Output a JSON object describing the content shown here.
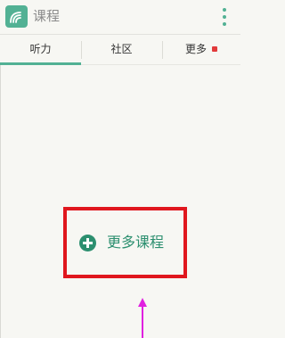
{
  "header": {
    "title": "课程",
    "logo_icon": "wifi-signal-icon",
    "menu_icon": "overflow-menu-icon"
  },
  "tabs": [
    {
      "label": "听力",
      "active": true
    },
    {
      "label": "社区",
      "active": false
    },
    {
      "label": "更多",
      "active": false,
      "badge": true
    }
  ],
  "main": {
    "more_courses_label": "更多课程",
    "more_courses_icon": "plus-circle-icon"
  },
  "colors": {
    "accent": "#52b194",
    "accent_dark": "#2c8f6f",
    "highlight_box": "#e0171e",
    "badge": "#e23b3b",
    "annotation_arrow": "#e020e0",
    "background": "#f7f7f3"
  }
}
